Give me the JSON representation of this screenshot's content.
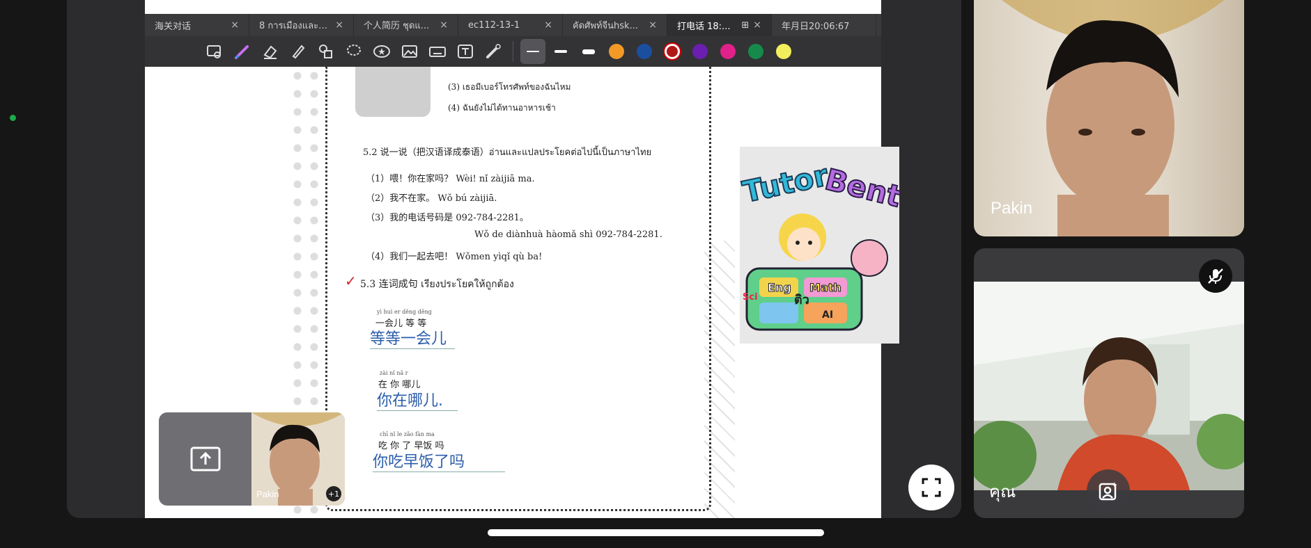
{
  "tabs": [
    {
      "label": "海关对话",
      "active": false
    },
    {
      "label": "8 การเมืองและก...",
      "active": false
    },
    {
      "label": "个人简历 ชุดแ...",
      "active": false
    },
    {
      "label": "ec112-13-1",
      "active": false
    },
    {
      "label": "คัดศัพท์จีนhsk...",
      "active": false
    },
    {
      "label": "打电话 18:...",
      "active": true
    },
    {
      "label": "年月日20:06:67",
      "active": false
    }
  ],
  "toolbar": {
    "tools": [
      "zoom-image-icon",
      "pen-icon",
      "eraser-icon",
      "highlighter-icon",
      "shapes-icon",
      "lasso-icon",
      "sticker-icon",
      "image-icon",
      "keyboard-icon",
      "textbox-icon",
      "laser-icon"
    ],
    "colors": [
      "#f39a26",
      "#1a4fa0",
      "#b01818",
      "#6a1fb0",
      "#e0218a",
      "#168a4a",
      "#f3ef5c"
    ],
    "selected_color": "#b01818"
  },
  "doc": {
    "thai_line_3": "(3) เธอมีเบอร์โทรศัพท์ของฉันไหม",
    "thai_line_4": "(4) ฉันยังไม่ได้ทานอาหารเช้า",
    "section52_title": "5.2  说一说（把汉语译成泰语）อ่านและแปลประโยคต่อไปนี้เป็นภาษาไทย",
    "l1": "（1）喂！你在家吗？   Wèi!  nǐ zàijiā ma.",
    "l2": "（2）我不在家。      Wǒ bú zàijiā.",
    "l3": "（3）我的电话号码是  092-784-2281。",
    "l3b": "Wǒ de diànhuà hàomǎ shì  092-784-2281.",
    "l4": "（4）我们一起去吧！  Wǒmen yìqǐ qù ba!",
    "section53_title": "5.3  连词成句  เรียงประโยคให้ถูกต้อง",
    "q1_pinyin": "yì huì er      děng   děng",
    "q1_words": "一会儿    等    等",
    "q1_answer": "等等一会儿",
    "q2_pinyin": "zài      nǐ        nǎ r",
    "q2_words": "在    你    哪儿",
    "q2_answer": "你在哪儿.",
    "q3_pinyin": "chī     nǐ     le    zǎo fàn     ma",
    "q3_words": "吃   你   了   早饭   吗",
    "q3_answer": "你吃早饭了吗"
  },
  "tutor": {
    "title": "Tutor Bento",
    "labels": [
      "Eng",
      "Math",
      "Sci",
      "ติว",
      "AI"
    ]
  },
  "participants": {
    "top": {
      "name": "Pakin"
    },
    "bottom": {
      "name": "คุณ"
    },
    "pip": {
      "name": "Pakin",
      "more": "+1"
    }
  }
}
